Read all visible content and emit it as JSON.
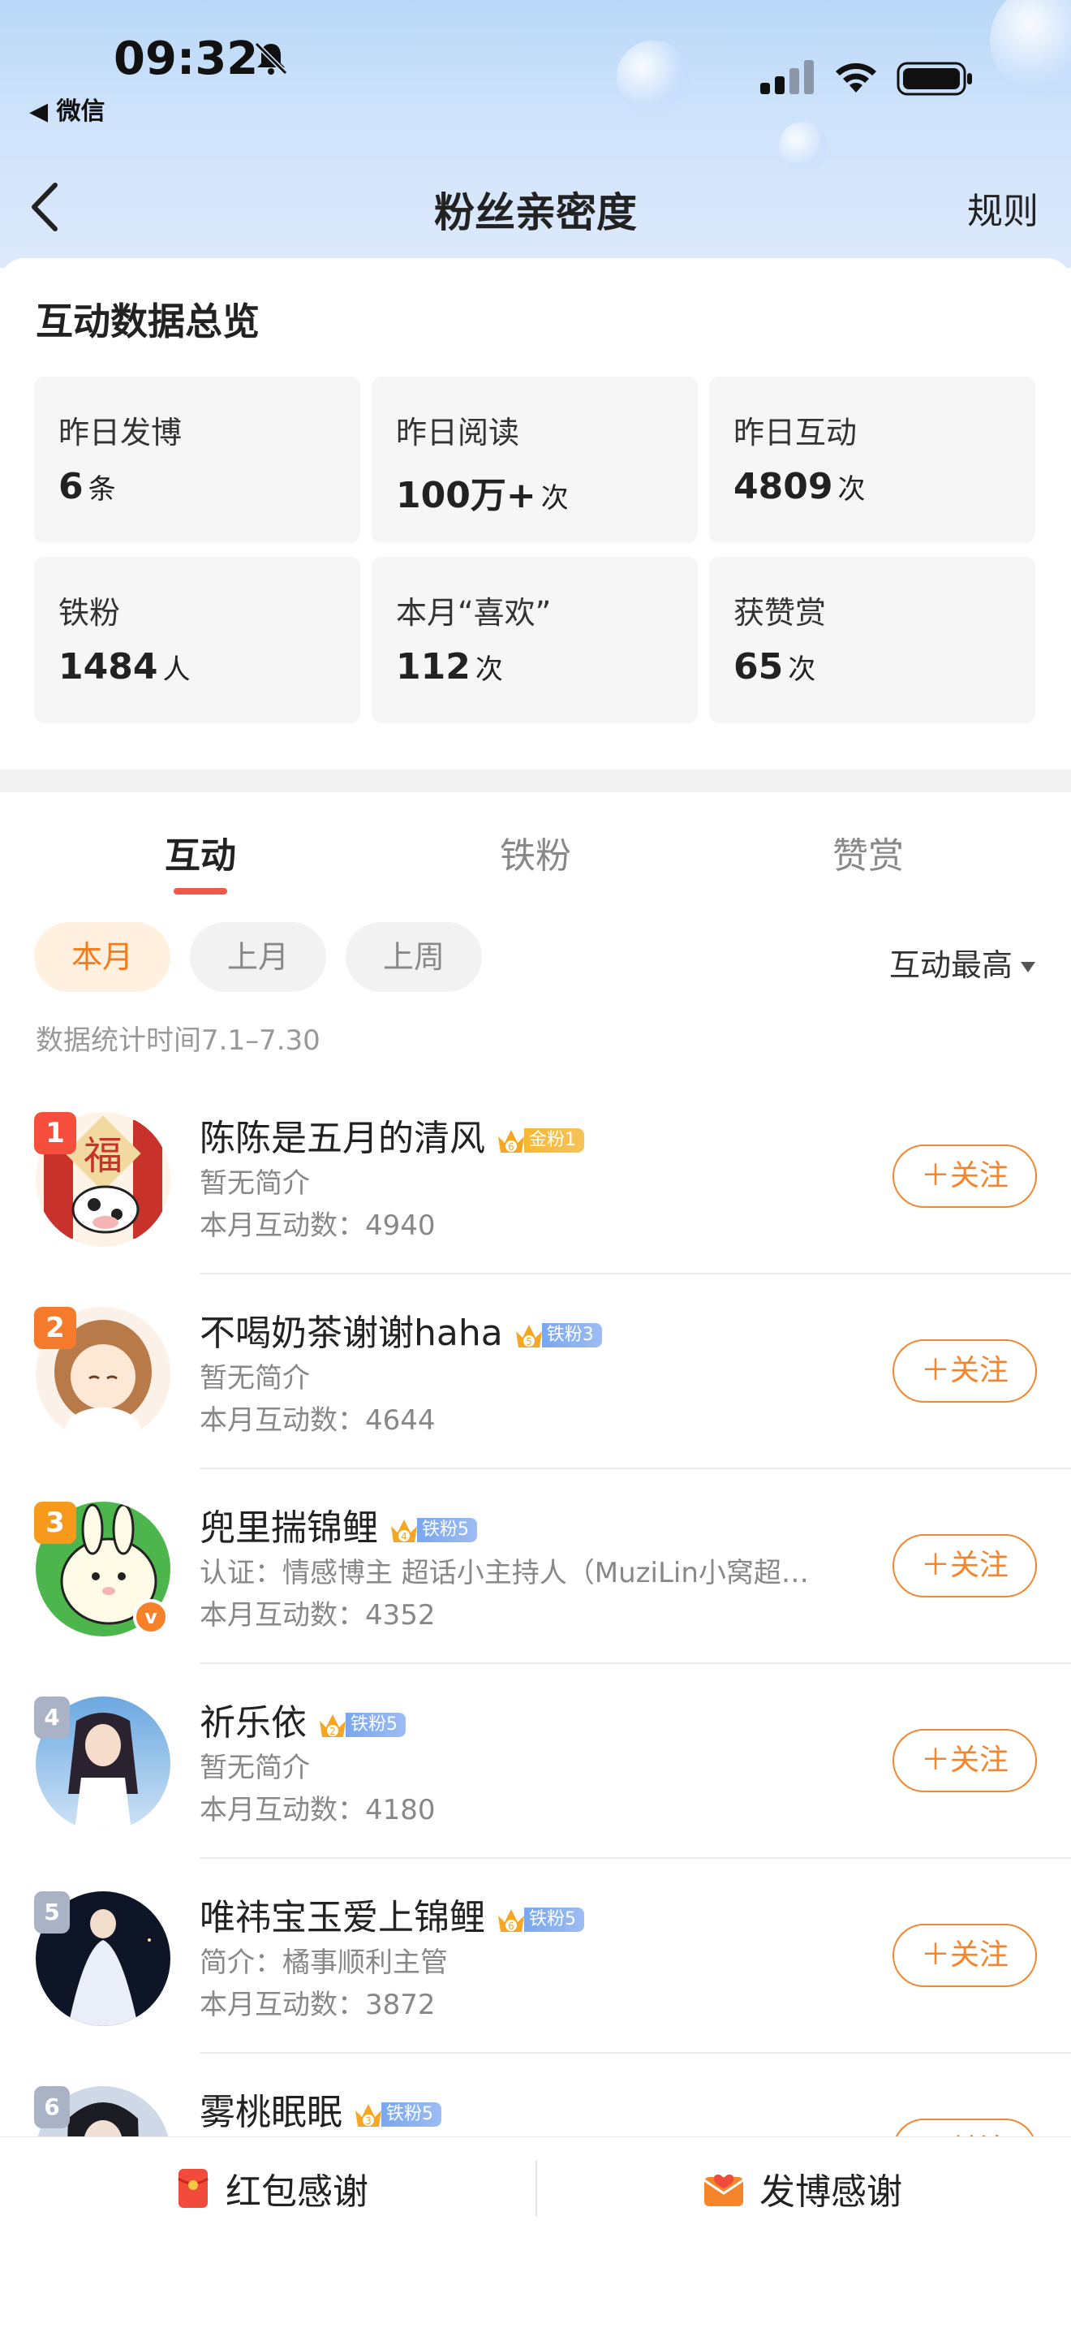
{
  "status_bar": {
    "time": "09:32",
    "back_app": "◀ 微信"
  },
  "nav": {
    "title": "粉丝亲密度",
    "rules": "规则"
  },
  "overview": {
    "title": "互动数据总览",
    "stats": [
      {
        "label": "昨日发博",
        "value": "6",
        "unit": "条"
      },
      {
        "label": "昨日阅读",
        "value": "100万+",
        "unit": "次"
      },
      {
        "label": "昨日互动",
        "value": "4809",
        "unit": "次"
      },
      {
        "label": "铁粉",
        "value": "1484",
        "unit": "人"
      },
      {
        "label": "本月“喜欢”",
        "value": "112",
        "unit": "次"
      },
      {
        "label": "获赞赏",
        "value": "65",
        "unit": "次"
      }
    ]
  },
  "tabs": [
    "互动",
    "铁粉",
    "赞赏"
  ],
  "filters": {
    "chips": [
      "本月",
      "上月",
      "上周"
    ],
    "sort": "互动最高"
  },
  "stat_period": "数据统计时间7.1–7.30",
  "fans": [
    {
      "rank": "1",
      "name": "陈陈是五月的清风",
      "badge_level": "6",
      "badge": "金粉1",
      "badge_type": "gold",
      "bio": "暂无简介",
      "count": "本月互动数：4940",
      "follow": "＋关注"
    },
    {
      "rank": "2",
      "name": "不喝奶茶谢谢haha",
      "badge_level": "5",
      "badge": "铁粉3",
      "badge_type": "iron",
      "bio": "暂无简介",
      "count": "本月互动数：4644",
      "follow": "＋关注"
    },
    {
      "rank": "3",
      "name": "兜里揣锦鲤",
      "badge_level": "4",
      "badge": "铁粉5",
      "badge_type": "iron",
      "bio": "认证：情感博主 超话小主持人（MuziLin小窝超…",
      "count": "本月互动数：4352",
      "follow": "＋关注"
    },
    {
      "rank": "4",
      "name": "祈乐依",
      "badge_level": "2",
      "badge": "铁粉5",
      "badge_type": "iron",
      "bio": "暂无简介",
      "count": "本月互动数：4180",
      "follow": "＋关注"
    },
    {
      "rank": "5",
      "name": "唯祎宝玉爱上锦鲤",
      "badge_level": "6",
      "badge": "铁粉5",
      "badge_type": "iron",
      "bio": "简介：橘事顺利主管",
      "count": "本月互动数：3872",
      "follow": "＋关注"
    },
    {
      "rank": "6",
      "name": "雾桃眠眠",
      "badge_level": "3",
      "badge": "铁粉5",
      "badge_type": "iron",
      "bio": "",
      "count": "",
      "follow": "＋关注"
    }
  ],
  "bottom": {
    "red_packet": "红包感谢",
    "post_thanks": "发博感谢"
  },
  "colors": {
    "accent": "#f5842a",
    "tab_indicator": "#f2574b",
    "gold_badge": "#f7b733",
    "iron_badge": "#7aa7f0"
  }
}
